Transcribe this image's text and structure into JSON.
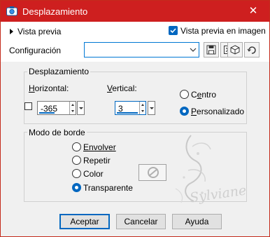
{
  "window": {
    "title": "Desplazamiento",
    "close_symbol": "✕"
  },
  "preview": {
    "toggle_label": "Vista previa",
    "checkbox_label": "Vista previa en imagen",
    "checkbox_checked": true
  },
  "config": {
    "label": "Configuración",
    "value": "",
    "tools": [
      "save-preset-icon",
      "reset-preset-icon",
      "randomize-icon",
      "undo-preset-icon"
    ]
  },
  "offset_group": {
    "title": "Desplazamiento",
    "horizontal_label": "Horizontal:",
    "horizontal_value": "-365",
    "vertical_label": "Vertical:",
    "vertical_value": "3",
    "center_label": "Centro",
    "custom_label": "Personalizado",
    "selected": "custom"
  },
  "edge_group": {
    "title": "Modo de borde",
    "options": [
      "Envolver",
      "Repetir",
      "Color",
      "Transparente"
    ],
    "selected": "Transparente"
  },
  "watermark_text": "Sylviane",
  "buttons": {
    "ok": "Aceptar",
    "cancel": "Cancelar",
    "help": "Ayuda"
  },
  "colors": {
    "titlebar": "#ce1f1f",
    "accent": "#0067c0",
    "window_bg": "#f0f0f0"
  }
}
